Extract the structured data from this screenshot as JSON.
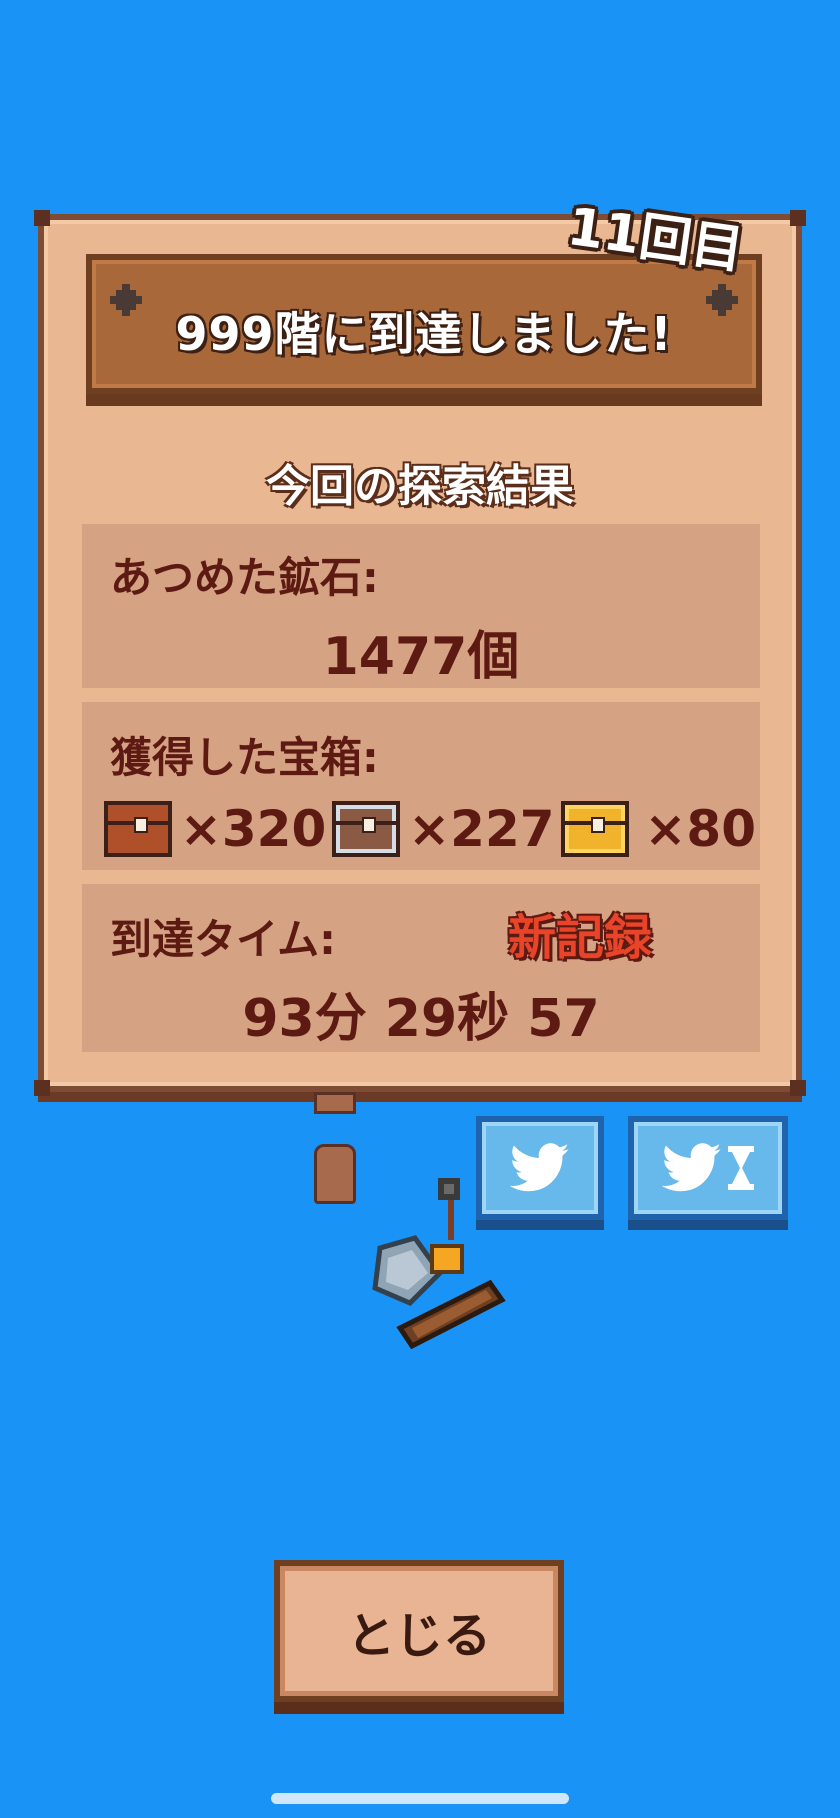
{
  "result": {
    "banner_title": "999階に到達しました!",
    "attempt_badge": "11回目",
    "section_title": "今回の探索結果",
    "ores": {
      "label": "あつめた鉱石:",
      "value": "1477個"
    },
    "chests": {
      "label": "獲得した宝箱:",
      "items": [
        {
          "type": "bronze",
          "icon": "bronze-chest-icon",
          "count": "×320"
        },
        {
          "type": "silver",
          "icon": "silver-chest-icon",
          "count": "×227"
        },
        {
          "type": "gold",
          "icon": "gold-chest-icon",
          "count": "×80"
        }
      ]
    },
    "time": {
      "label": "到達タイム:",
      "value": "93分 29秒 57",
      "new_record_label": "新記録"
    }
  },
  "share": {
    "twitter_icon": "twitter-bird-icon",
    "twitter_timer_icon": "hourglass-icon"
  },
  "close_button_label": "とじる",
  "colors": {
    "background": "#1a93f6",
    "panel": "#e9b792",
    "banner": "#a8683a",
    "text_dark": "#5c1a12",
    "new_record": "#e8442a",
    "twitter_button": "#67b9ec"
  }
}
